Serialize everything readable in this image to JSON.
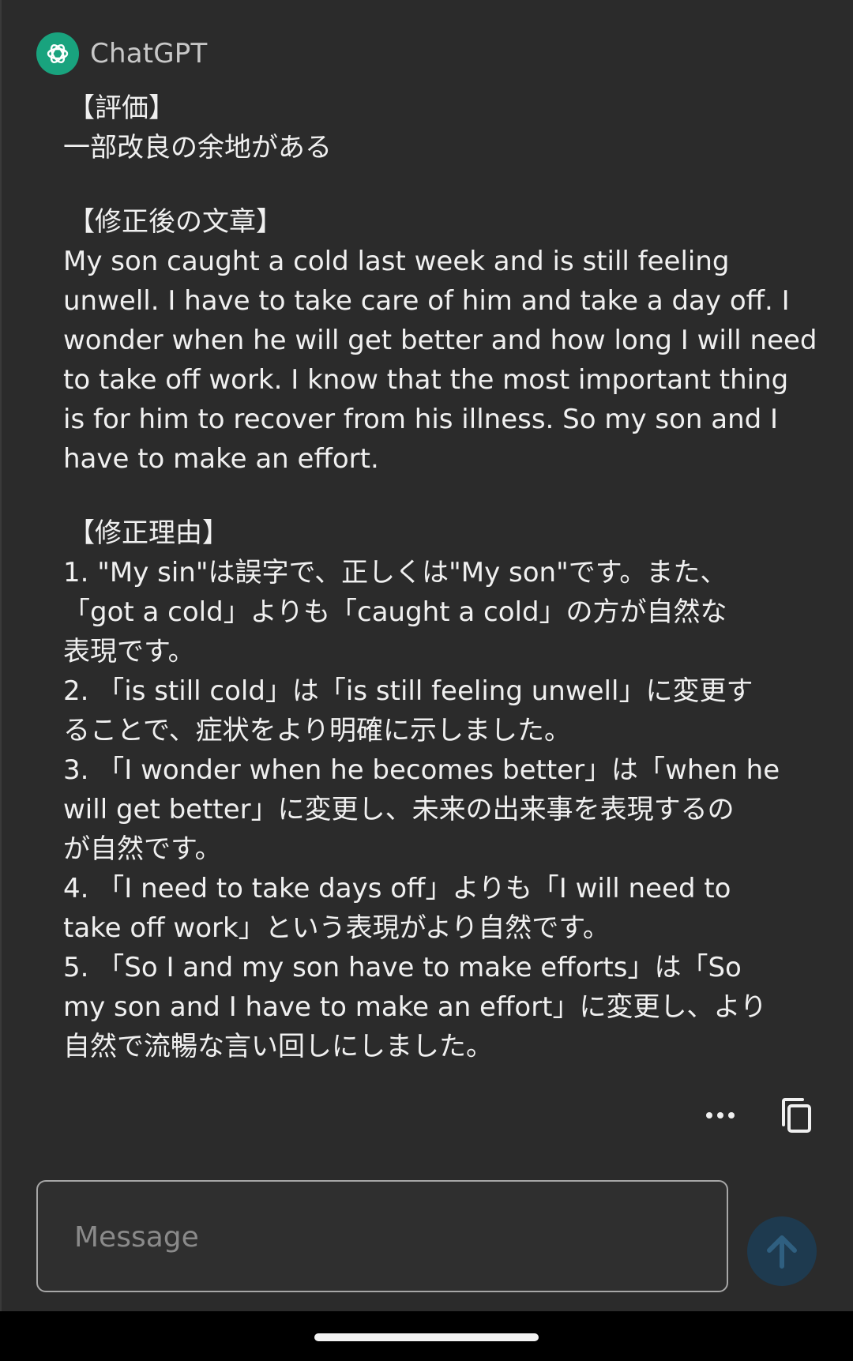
{
  "header": {
    "author_name": "ChatGPT",
    "avatar_icon": "openai-logo-icon",
    "avatar_color": "#19a37e"
  },
  "message": {
    "evaluation_heading": "【評価】",
    "evaluation_body": "一部改良の余地がある",
    "corrected_heading": "【修正後の文章】",
    "corrected_lines": [
      "My son caught a cold last week and is still feeling",
      "unwell. I have to take care of him and take a day off. I",
      "wonder when he will get better and how long I will need",
      "to take off work. I know that the most important thing",
      "is for him to recover from his illness. So my son and I",
      "have to make an effort."
    ],
    "reason_heading": "【修正理由】",
    "reason_lines": [
      "1. \"My sin\"は誤字で、正しくは\"My son\"です。また、",
      "「got a cold」よりも「caught a cold」の方が自然な",
      "表現です。",
      "2. 「is still cold」は「is still feeling unwell」に変更す",
      "ることで、症状をより明確に示しました。",
      "3. 「I wonder when he becomes better」は「when he",
      "will get better」に変更し、未来の出来事を表現するの",
      "が自然です。",
      "4. 「I need to take days off」よりも「I will need to",
      "take off work」という表現がより自然です。",
      "5. 「So I and my son have to make efforts」は「So",
      "my son and I have to make an effort」に変更し、より",
      "自然で流暢な言い回しにしました。"
    ]
  },
  "actions": {
    "more_icon": "more-horizontal-icon",
    "copy_icon": "copy-icon"
  },
  "composer": {
    "placeholder": "Message",
    "value": "",
    "send_icon": "arrow-up-icon",
    "send_color": "#1e3a4f"
  }
}
